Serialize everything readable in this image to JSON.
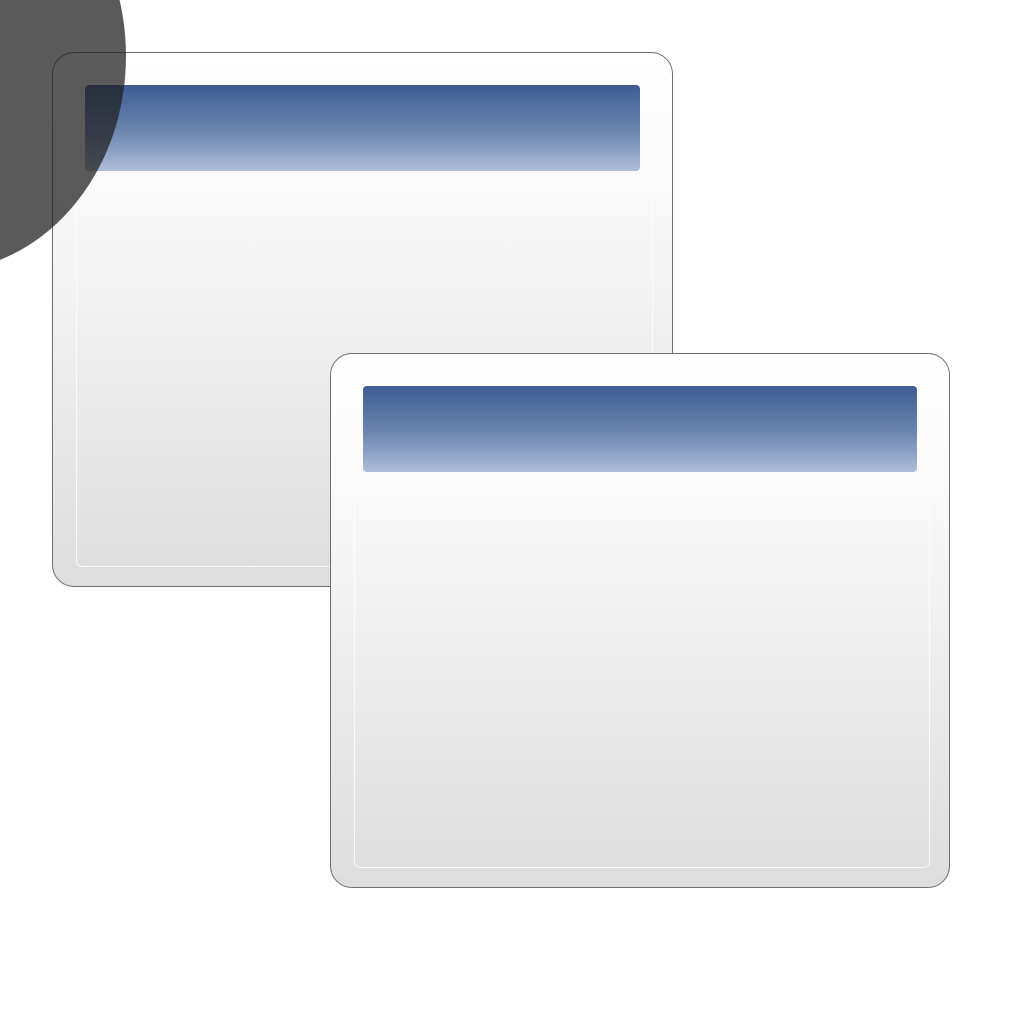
{
  "theme": {
    "title_bar_top": "#3e5c93",
    "title_bar_bottom": "#afbdd6",
    "window_border": "#6e6e6e",
    "window_body_top": "#ffffff",
    "window_body_bottom": "#dedede",
    "overlay": "#202020"
  },
  "windows": [
    {
      "name": "back-window",
      "title": ""
    },
    {
      "name": "front-window",
      "title": ""
    }
  ]
}
